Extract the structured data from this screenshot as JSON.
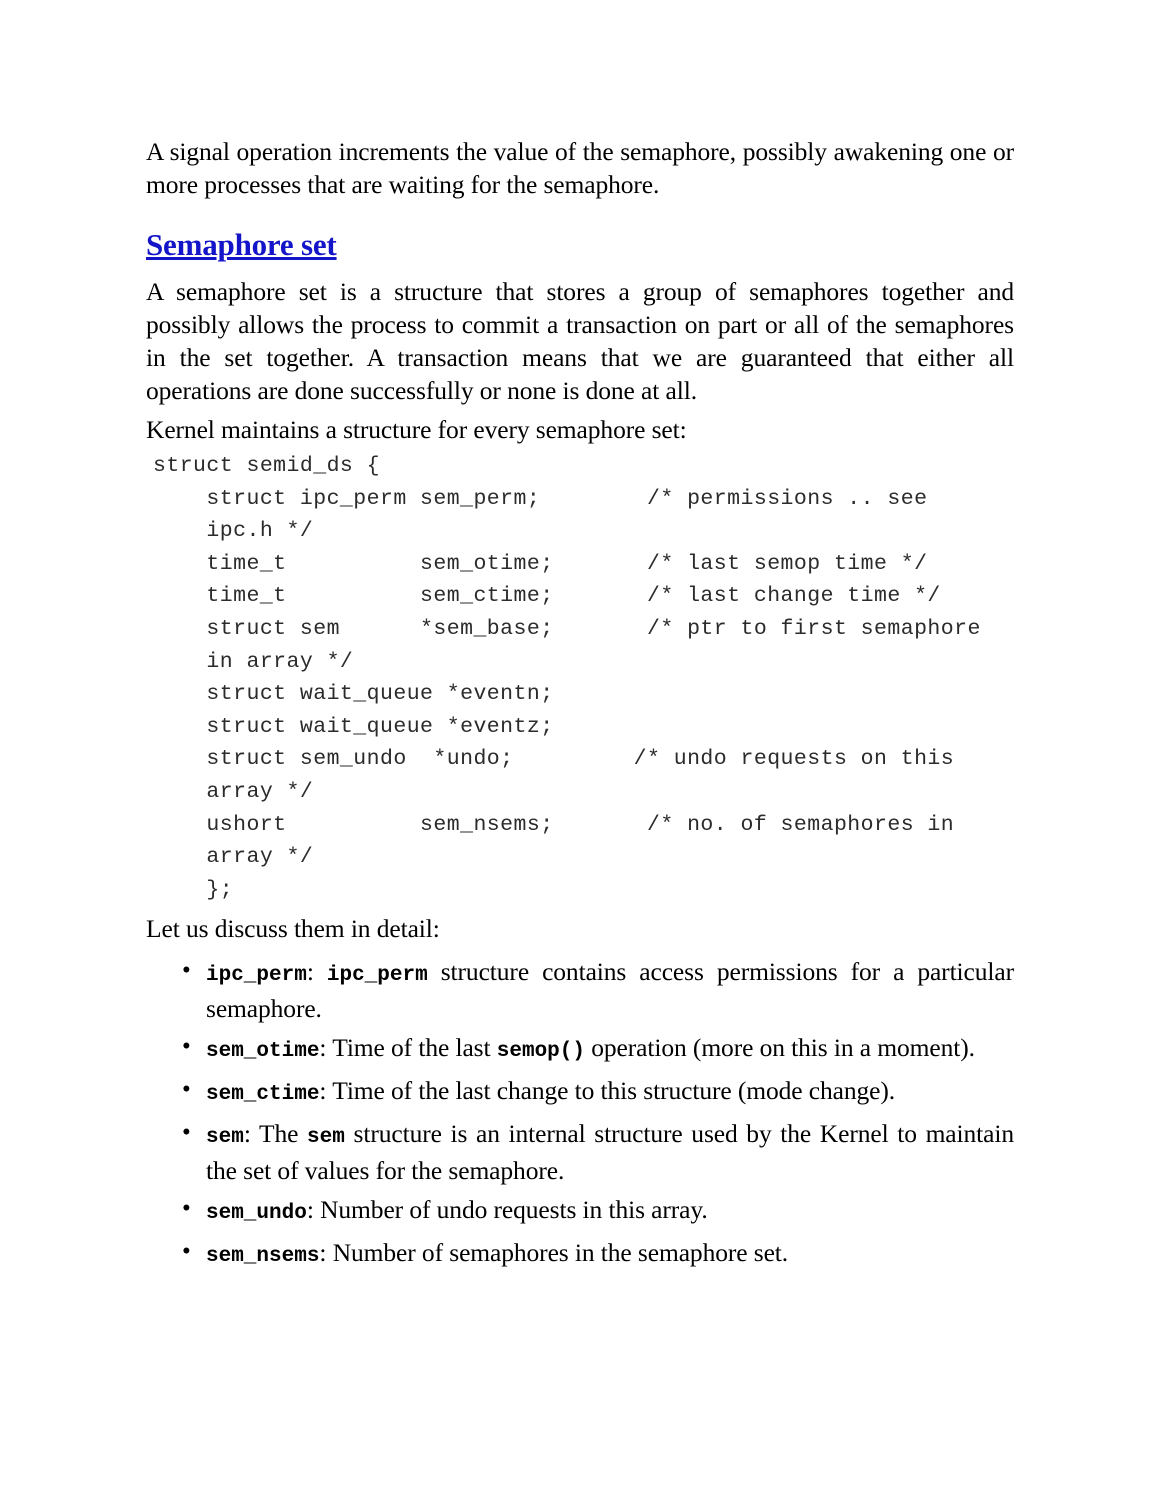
{
  "document": {
    "intro_paragraph": "A signal operation increments the value of the semaphore, possibly awakening one or more processes that are waiting for the semaphore.",
    "heading": {
      "text": "Semaphore set",
      "color": "#1414c8",
      "underlined": true
    },
    "body_paragraph": "A semaphore set is a structure that stores a group of semaphores together and possibly allows the process to commit a transaction on part or all of the semaphores in the set together. A transaction means that we are guaranteed that either all operations are done successfully or none is done at all.",
    "code_intro": "Kernel maintains a structure for every semaphore set:",
    "code_block": "struct semid_ds {\n    struct ipc_perm sem_perm;        /* permissions .. see\n    ipc.h */\n    time_t          sem_otime;       /* last semop time */\n    time_t          sem_ctime;       /* last change time */\n    struct sem      *sem_base;       /* ptr to first semaphore\n    in array */\n    struct wait_queue *eventn;\n    struct wait_queue *eventz;\n    struct sem_undo  *undo;         /* undo requests on this\n    array */\n    ushort          sem_nsems;       /* no. of semaphores in\n    array */\n    };",
    "list_intro": "Let us discuss them in detail:",
    "bullets": [
      {
        "term": "ipc_perm",
        "sep": ": ",
        "inline_code_1": "ipc_perm",
        "text_after_1": " structure contains access permissions for a particular semaphore.",
        "justified": true
      },
      {
        "term": "sem_otime",
        "sep": ": ",
        "text_before": "Time of the last ",
        "inline_code_1": "semop()",
        "text_after_1": " operation (more on this in a moment).",
        "justified": true
      },
      {
        "term": "sem_ctime",
        "sep": ": ",
        "text_before": "Time of the last change to this structure (mode change).",
        "justified": false
      },
      {
        "term": "sem",
        "sep": ": ",
        "text_before": "The ",
        "inline_code_1": "sem",
        "text_after_1": " structure is an internal structure used by the Kernel to maintain the set of values for the semaphore.",
        "justified": true
      },
      {
        "term": "sem_undo",
        "sep": ": ",
        "text_before": "Number of undo requests in this array.",
        "justified": false
      },
      {
        "term": "sem_nsems",
        "sep": ": ",
        "text_before": "Number of semaphores in the semaphore set.",
        "justified": false
      }
    ]
  }
}
